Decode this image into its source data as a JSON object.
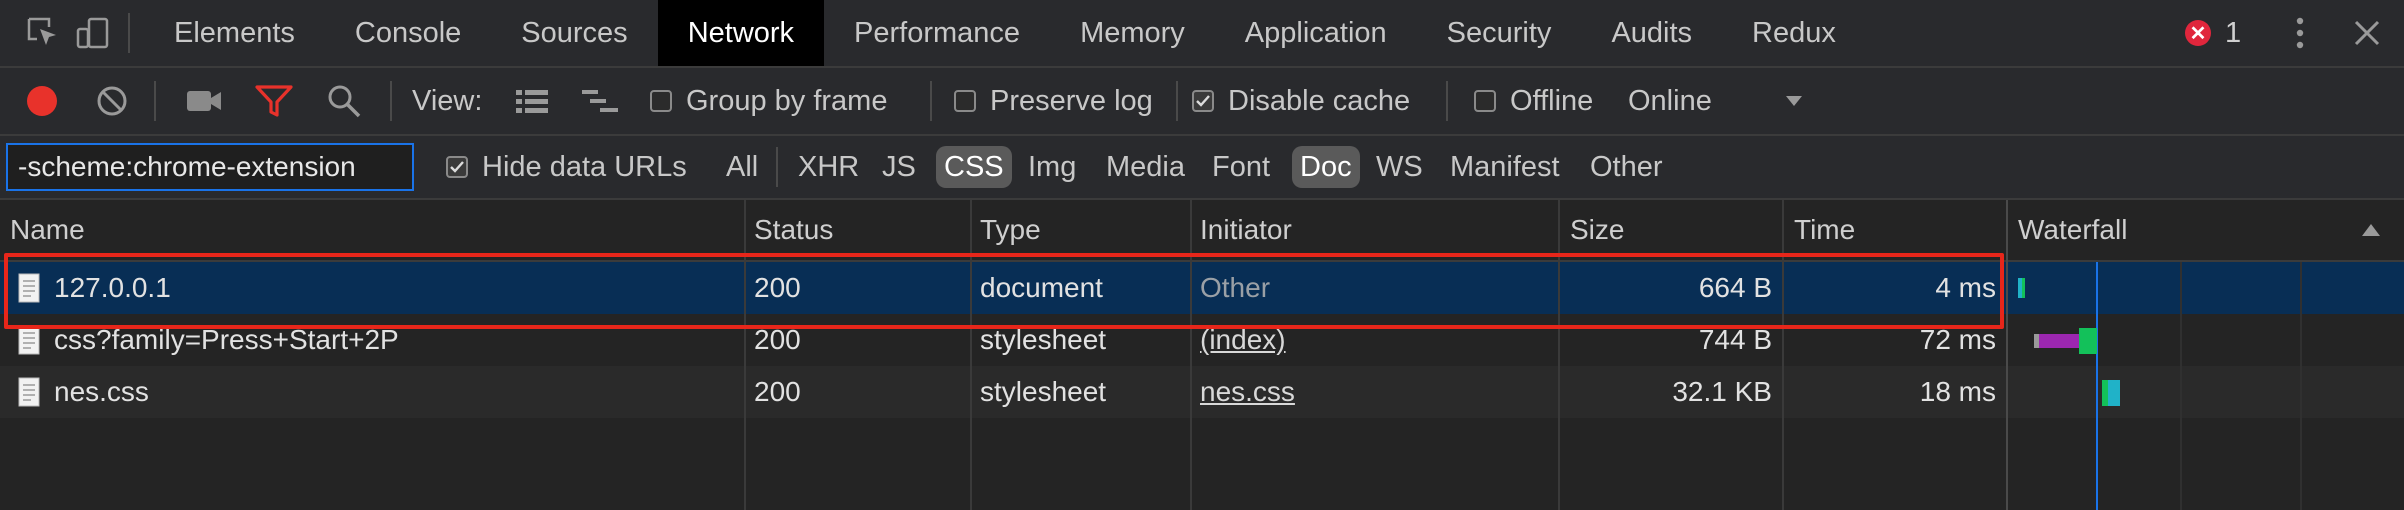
{
  "tabs": {
    "items": [
      "Elements",
      "Console",
      "Sources",
      "Network",
      "Performance",
      "Memory",
      "Application",
      "Security",
      "Audits",
      "Redux"
    ],
    "active": "Network",
    "error_count": "1"
  },
  "toolbar": {
    "view_label": "View:",
    "group_by_frame": "Group by frame",
    "preserve_log": "Preserve log",
    "disable_cache": "Disable cache",
    "offline": "Offline",
    "throttling": "Online",
    "record_color": "#e8322b",
    "filter_active_color": "#e8322b"
  },
  "filter": {
    "value": "-scheme:chrome-extension",
    "hide_data_urls": "Hide data URLs",
    "types": [
      "All",
      "XHR",
      "JS",
      "CSS",
      "Img",
      "Media",
      "Font",
      "Doc",
      "WS",
      "Manifest",
      "Other"
    ],
    "selected": [
      "CSS",
      "Doc"
    ]
  },
  "table": {
    "headers": {
      "name": "Name",
      "status": "Status",
      "type": "Type",
      "initiator": "Initiator",
      "size": "Size",
      "time": "Time",
      "waterfall": "Waterfall"
    },
    "rows": [
      {
        "name": "127.0.0.1",
        "status": "200",
        "type": "document",
        "initiator": "Other",
        "size": "664 B",
        "time": "4 ms"
      },
      {
        "name": "css?family=Press+Start+2P",
        "status": "200",
        "type": "stylesheet",
        "initiator": "(index)",
        "size": "744 B",
        "time": "72 ms"
      },
      {
        "name": "nes.css",
        "status": "200",
        "type": "stylesheet",
        "initiator": "nes.css",
        "size": "32.1 KB",
        "time": "18 ms"
      }
    ]
  },
  "colors": {
    "selected_row": "#082e55",
    "highlight_box": "#e8261a",
    "waterfall_purple": "#9c27b0",
    "waterfall_green": "#13c15a",
    "waterfall_teal": "#20b2c8",
    "waterfall_line": "#1a73e8"
  }
}
